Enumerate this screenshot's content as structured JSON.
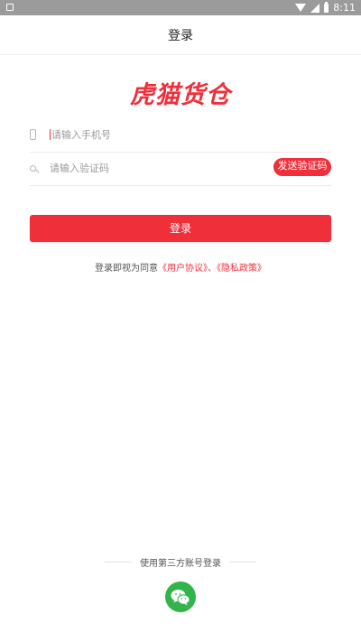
{
  "status_bar": {
    "time": "8:11"
  },
  "header": {
    "title": "登录"
  },
  "logo": {
    "text": "虎猫货仓"
  },
  "phone_field": {
    "placeholder": "请输入手机号",
    "value": ""
  },
  "code_field": {
    "placeholder": "请输入验证码",
    "value": ""
  },
  "send_code_label": "发送验证码",
  "login_button_label": "登录",
  "agreement": {
    "prefix": "登录即视为同意",
    "user_agreement": "《用户协议》",
    "separator": "、",
    "privacy_policy": "《隐私政策》"
  },
  "third_party": {
    "label": "使用第三方账号登录"
  },
  "colors": {
    "accent": "#ef2f3a",
    "wechat": "#31b54a",
    "status_bar": "#9b9b9b"
  },
  "icons": [
    "phone-icon",
    "key-icon",
    "wechat-icon",
    "wifi-icon",
    "signal-icon",
    "battery-icon"
  ]
}
